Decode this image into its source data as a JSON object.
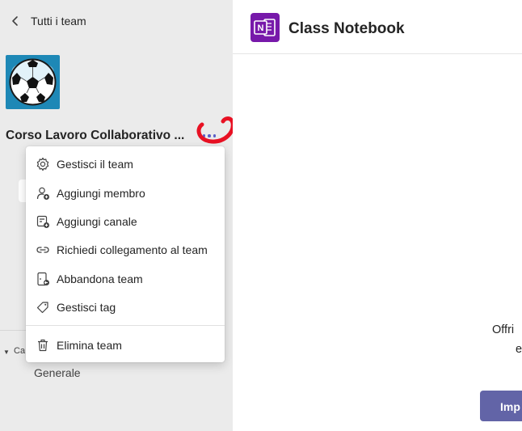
{
  "sidebar": {
    "back_label": "Tutti i team",
    "team_name": "Corso Lavoro Collaborativo ...",
    "channels_label": "Canali",
    "channels": [
      {
        "label": "Generale"
      }
    ]
  },
  "context_menu": {
    "items": [
      {
        "label": "Gestisci il team",
        "icon": "gear-icon"
      },
      {
        "label": "Aggiungi membro",
        "icon": "add-person-icon"
      },
      {
        "label": "Aggiungi canale",
        "icon": "add-channel-icon"
      },
      {
        "label": "Richiedi collegamento al team",
        "icon": "link-icon"
      },
      {
        "label": "Abbandona team",
        "icon": "leave-icon"
      },
      {
        "label": "Gestisci tag",
        "icon": "tag-icon"
      },
      {
        "label": "Elimina team",
        "icon": "trash-icon"
      }
    ]
  },
  "main": {
    "app_title": "Class Notebook",
    "offer_text_line1": "Offri",
    "offer_text_line2": "e",
    "cta_label": "Imp"
  },
  "colors": {
    "accent": "#5b5fc7",
    "onenote": "#7719aa",
    "team_avatar_bg": "#1e88b6",
    "annotation_red": "#e81123",
    "cta": "#6264a7"
  }
}
